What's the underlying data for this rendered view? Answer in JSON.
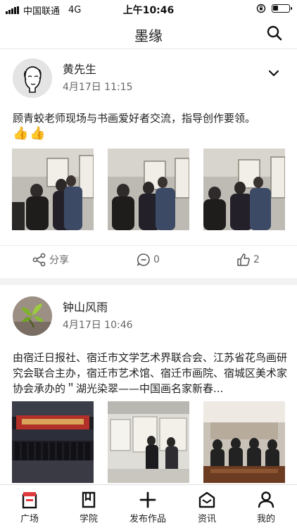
{
  "status_bar": {
    "carrier": "中国联通",
    "network": "4G",
    "time": "上午10:46"
  },
  "nav": {
    "title": "墨缘",
    "search_icon": "search-icon"
  },
  "posts": [
    {
      "author": "黄先生",
      "time": "4月17日 11:15",
      "text": "顾青蛟老师现场与书画爱好者交流，指导创作要领。",
      "emoji": "👍👍",
      "actions": {
        "share": "分享",
        "comments": "0",
        "likes": "2"
      }
    },
    {
      "author": "钟山风雨",
      "time": "4月17日 10:46",
      "text": "由宿迁日报社、宿迁市文学艺术界联合会、江苏省花鸟画研究会联合主办，宿迁市艺术馆、宿迁市画院、宿城区美术家协会承办的＂湖光染翠——中国画名家新春..."
    }
  ],
  "tabs": [
    {
      "label": "广场",
      "icon": "plaza-icon"
    },
    {
      "label": "学院",
      "icon": "academy-icon"
    },
    {
      "label": "发布作品",
      "icon": "plus-icon"
    },
    {
      "label": "资讯",
      "icon": "news-icon"
    },
    {
      "label": "我的",
      "icon": "profile-icon"
    }
  ],
  "colors": {
    "accent": "#e0393e",
    "text": "#222222",
    "muted": "#666666",
    "divider": "#f2f2f2"
  }
}
